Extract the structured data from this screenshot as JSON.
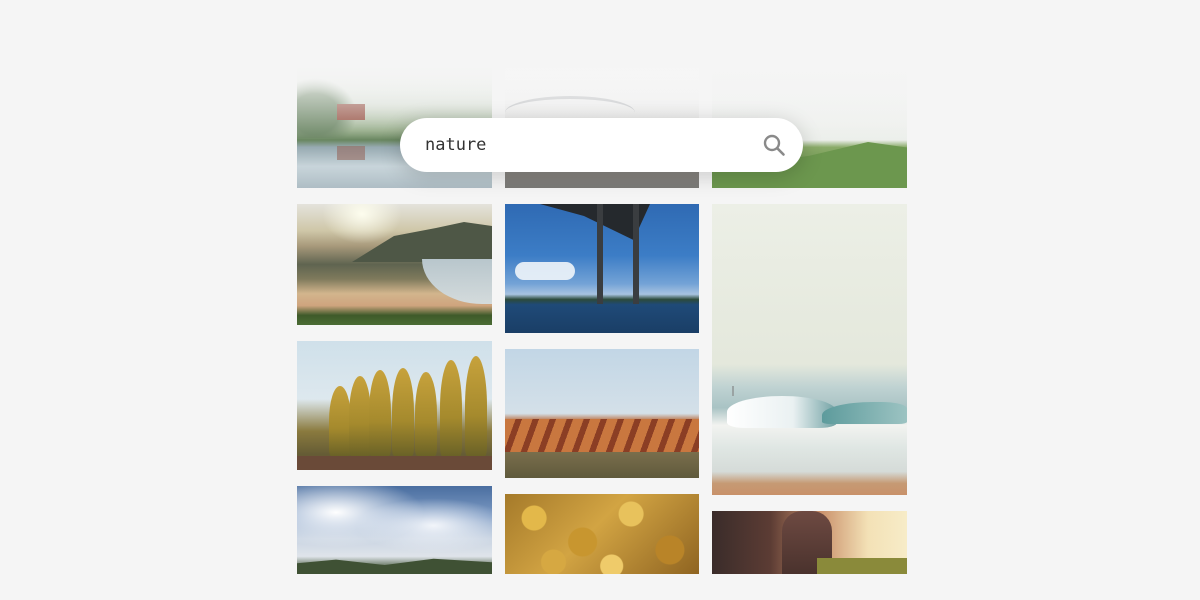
{
  "search": {
    "value": "nature",
    "icon": "search-icon"
  },
  "gallery": {
    "photos": [
      {
        "name": "lake-barn-photo"
      },
      {
        "name": "coastal-town-photo"
      },
      {
        "name": "poplar-trees-photo"
      },
      {
        "name": "cloudy-sky-photo"
      },
      {
        "name": "foggy-bridge-photo"
      },
      {
        "name": "bridge-over-water-photo"
      },
      {
        "name": "vineyard-rows-photo"
      },
      {
        "name": "autumn-leaves-photo"
      },
      {
        "name": "green-field-photo"
      },
      {
        "name": "surfing-wave-photo"
      },
      {
        "name": "sunset-hand-photo"
      }
    ]
  },
  "colors": {
    "background": "#f5f5f5",
    "search_background": "#ffffff",
    "search_icon": "#8a8a8a"
  }
}
